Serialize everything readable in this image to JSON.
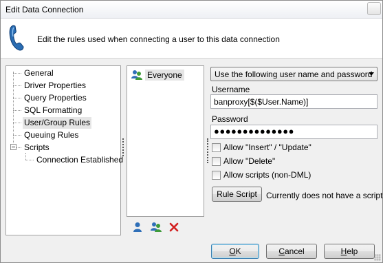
{
  "window": {
    "title": "Edit Data Connection"
  },
  "header": {
    "description": "Edit the rules used when connecting a user to this data connection"
  },
  "tree": {
    "items": [
      {
        "label": "General"
      },
      {
        "label": "Driver Properties"
      },
      {
        "label": "Query Properties"
      },
      {
        "label": "SQL Formatting"
      },
      {
        "label": "User/Group Rules"
      },
      {
        "label": "Queuing Rules"
      },
      {
        "label": "Scripts"
      },
      {
        "label": "Connection Established"
      }
    ]
  },
  "users": {
    "items": [
      {
        "label": "Everyone"
      }
    ]
  },
  "form": {
    "mode": "Use the following user name and password",
    "username_label": "Username",
    "username_value": "banproxy[$($User.Name)]",
    "password_label": "Password",
    "password_mask": "●●●●●●●●●●●●●●",
    "allow_insert_update": "Allow \"Insert\" / \"Update\"",
    "allow_delete": "Allow \"Delete\"",
    "allow_scripts": "Allow scripts (non-DML)",
    "rule_script_button": "Rule Script",
    "script_status": "Currently does not have a script"
  },
  "buttons": {
    "ok_mnemonic": "O",
    "ok_rest": "K",
    "cancel_mnemonic": "C",
    "cancel_rest": "ancel",
    "help_mnemonic": "H",
    "help_rest": "elp"
  },
  "colors": {
    "user_icon_blue": "#2f6fb8",
    "group_icon_green": "#3e9b3a",
    "delete_red": "#d21e1e"
  }
}
